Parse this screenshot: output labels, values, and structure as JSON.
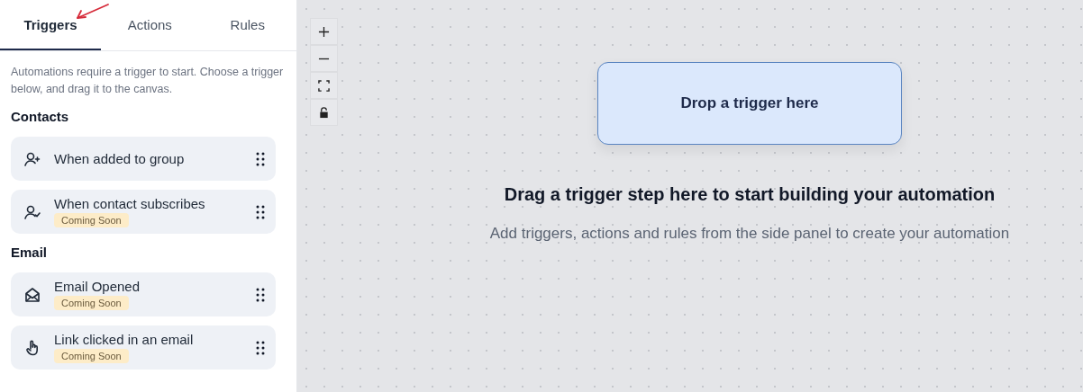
{
  "tabs": [
    {
      "label": "Triggers",
      "selected": true
    },
    {
      "label": "Actions",
      "selected": false
    },
    {
      "label": "Rules",
      "selected": false
    }
  ],
  "description": "Automations require a trigger to start. Choose a trigger below, and drag it to the canvas.",
  "sections": [
    {
      "title": "Contacts",
      "items": [
        {
          "label": "When added to group"
        },
        {
          "label": "When contact subscribes",
          "badge": "Coming Soon"
        }
      ]
    },
    {
      "title": "Email",
      "items": [
        {
          "label": "Email Opened",
          "badge": "Coming Soon"
        },
        {
          "label": "Link clicked in an email",
          "badge": "Coming Soon"
        }
      ]
    }
  ],
  "canvas": {
    "drop_zone": "Drop a trigger here",
    "heading": "Drag a trigger step here to start building your automation",
    "subtitle": "Add triggers, actions and rules from the side panel to create your automation"
  }
}
